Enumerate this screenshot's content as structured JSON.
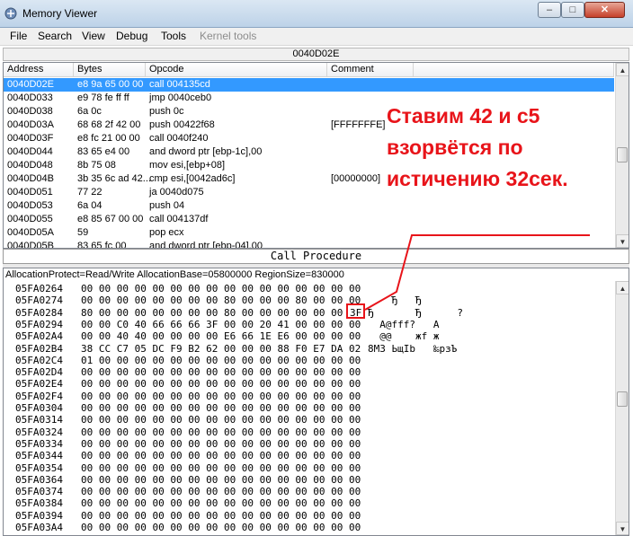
{
  "window": {
    "title": "Memory Viewer",
    "minimize": "–",
    "maximize": "□",
    "close": "✕"
  },
  "menu": [
    {
      "label": "File",
      "enabled": true
    },
    {
      "label": "Search",
      "enabled": true
    },
    {
      "label": "View",
      "enabled": true
    },
    {
      "label": "Debug",
      "enabled": true
    },
    {
      "label": "Tools",
      "enabled": true
    },
    {
      "label": "Kernel tools",
      "enabled": false
    }
  ],
  "address_header": "0040D02E",
  "disassembly": {
    "columns": [
      "Address",
      "Bytes",
      "Opcode",
      "Comment"
    ],
    "rows": [
      {
        "address": "0040D02E",
        "bytes": "e8 9a 65 00 00",
        "opcode": "call 004135cd",
        "comment": "",
        "selected": true
      },
      {
        "address": "0040D033",
        "bytes": "e9 78 fe ff ff",
        "opcode": "jmp 0040ceb0",
        "comment": ""
      },
      {
        "address": "0040D038",
        "bytes": "6a 0c",
        "opcode": "push 0c",
        "comment": ""
      },
      {
        "address": "0040D03A",
        "bytes": "68 68 2f 42 00",
        "opcode": "push 00422f68",
        "comment": "[FFFFFFFE]"
      },
      {
        "address": "0040D03F",
        "bytes": "e8 fc 21 00 00",
        "opcode": "call 0040f240",
        "comment": ""
      },
      {
        "address": "0040D044",
        "bytes": "83 65 e4 00",
        "opcode": "and dword ptr [ebp-1c],00",
        "comment": ""
      },
      {
        "address": "0040D048",
        "bytes": "8b 75 08",
        "opcode": "mov esi,[ebp+08]",
        "comment": ""
      },
      {
        "address": "0040D04B",
        "bytes": "3b 35 6c ad 42...",
        "opcode": "cmp esi,[0042ad6c]",
        "comment": "[00000000]"
      },
      {
        "address": "0040D051",
        "bytes": "77 22",
        "opcode": "ja 0040d075",
        "comment": ""
      },
      {
        "address": "0040D053",
        "bytes": "6a 04",
        "opcode": "push 04",
        "comment": ""
      },
      {
        "address": "0040D055",
        "bytes": "e8 85 67 00 00",
        "opcode": "call 004137df",
        "comment": ""
      },
      {
        "address": "0040D05A",
        "bytes": "59",
        "opcode": "pop ecx",
        "comment": ""
      },
      {
        "address": "0040D05B",
        "bytes": "83 65 fc 00",
        "opcode": "and dword ptr [ebp-04],00",
        "comment": ""
      }
    ]
  },
  "call_procedure": "Call Procedure",
  "hex_view": {
    "info": "AllocationProtect=Read/Write  AllocationBase=05800000 RegionSize=830000",
    "rows": [
      {
        "addr": "05FA0264",
        "bytes": "00 00 00 00 00 00 00 00 00 00 00 00 00 00 00 00",
        "ascii": ""
      },
      {
        "addr": "05FA0274",
        "bytes": "00 00 00 00 00 00 00 00 80 00 00 00 80 00 00 00",
        "ascii": "    Ђ   Ђ"
      },
      {
        "addr": "05FA0284",
        "bytes": "80 00 00 00 00 00 00 00 80 00 00 00 00 00 00 ",
        "ascii": "Ђ       Ђ      ?",
        "highlight": "3F"
      },
      {
        "addr": "05FA0294",
        "bytes": "00 00 C0 40 66 66 66 3F 00 00 20 41 00 00 00 00",
        "ascii": "  А@fff?   A"
      },
      {
        "addr": "05FA02A4",
        "bytes": "00 00 40 40 00 00 00 00 E6 66 1E E6 00 00 00 00",
        "ascii": "  @@    жf ж"
      },
      {
        "addr": "05FA02B4",
        "bytes": "38 CC C7 05 DC F9 B2 62 00 00 00 88 F0 E7 DA 02",
        "ascii": "8МЗ ЬщІb   ‰рзЪ"
      },
      {
        "addr": "05FA02C4",
        "bytes": "01 00 00 00 00 00 00 00 00 00 00 00 00 00 00 00",
        "ascii": ""
      },
      {
        "addr": "05FA02D4",
        "bytes": "00 00 00 00 00 00 00 00 00 00 00 00 00 00 00 00",
        "ascii": ""
      },
      {
        "addr": "05FA02E4",
        "bytes": "00 00 00 00 00 00 00 00 00 00 00 00 00 00 00 00",
        "ascii": ""
      },
      {
        "addr": "05FA02F4",
        "bytes": "00 00 00 00 00 00 00 00 00 00 00 00 00 00 00 00",
        "ascii": ""
      },
      {
        "addr": "05FA0304",
        "bytes": "00 00 00 00 00 00 00 00 00 00 00 00 00 00 00 00",
        "ascii": ""
      },
      {
        "addr": "05FA0314",
        "bytes": "00 00 00 00 00 00 00 00 00 00 00 00 00 00 00 00",
        "ascii": ""
      },
      {
        "addr": "05FA0324",
        "bytes": "00 00 00 00 00 00 00 00 00 00 00 00 00 00 00 00",
        "ascii": ""
      },
      {
        "addr": "05FA0334",
        "bytes": "00 00 00 00 00 00 00 00 00 00 00 00 00 00 00 00",
        "ascii": ""
      },
      {
        "addr": "05FA0344",
        "bytes": "00 00 00 00 00 00 00 00 00 00 00 00 00 00 00 00",
        "ascii": ""
      },
      {
        "addr": "05FA0354",
        "bytes": "00 00 00 00 00 00 00 00 00 00 00 00 00 00 00 00",
        "ascii": ""
      },
      {
        "addr": "05FA0364",
        "bytes": "00 00 00 00 00 00 00 00 00 00 00 00 00 00 00 00",
        "ascii": ""
      },
      {
        "addr": "05FA0374",
        "bytes": "00 00 00 00 00 00 00 00 00 00 00 00 00 00 00 00",
        "ascii": ""
      },
      {
        "addr": "05FA0384",
        "bytes": "00 00 00 00 00 00 00 00 00 00 00 00 00 00 00 00",
        "ascii": ""
      },
      {
        "addr": "05FA0394",
        "bytes": "00 00 00 00 00 00 00 00 00 00 00 00 00 00 00 00",
        "ascii": ""
      },
      {
        "addr": "05FA03A4",
        "bytes": "00 00 00 00 00 00 00 00 00 00 00 00 00 00 00 00",
        "ascii": ""
      }
    ]
  },
  "annotation": {
    "lines": [
      "Ставим 42 и с5",
      "взорвётся по",
      "истичению 32сек."
    ],
    "color": "#e8141a"
  },
  "colors": {
    "selection": "#3399ff",
    "annotation": "#e8141a"
  }
}
